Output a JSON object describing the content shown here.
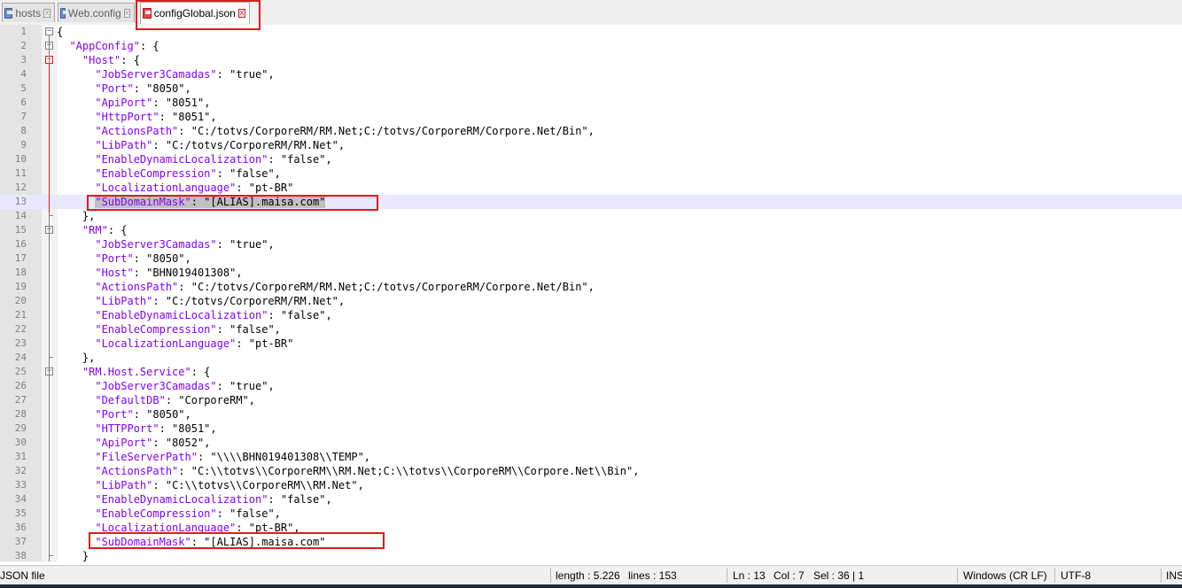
{
  "tabs": [
    {
      "label": "hosts",
      "close": "x",
      "active": false
    },
    {
      "label": "Web.config",
      "close": "x",
      "active": false
    },
    {
      "label": "configGlobal.json",
      "close": "x",
      "active": true
    }
  ],
  "editor": {
    "current_line": 13,
    "lines": [
      {
        "n": "1",
        "text": "{"
      },
      {
        "n": "2",
        "text": "  \"AppConfig\": {"
      },
      {
        "n": "3",
        "text": "    \"Host\": {"
      },
      {
        "n": "4",
        "text": "      \"JobServer3Camadas\": \"true\","
      },
      {
        "n": "5",
        "text": "      \"Port\": \"8050\","
      },
      {
        "n": "6",
        "text": "      \"ApiPort\": \"8051\","
      },
      {
        "n": "7",
        "text": "      \"HttpPort\": \"8051\","
      },
      {
        "n": "8",
        "text": "      \"ActionsPath\": \"C:/totvs/CorporeRM/RM.Net;C:/totvs/CorporeRM/Corpore.Net/Bin\","
      },
      {
        "n": "9",
        "text": "      \"LibPath\": \"C:/totvs/CorporeRM/RM.Net\","
      },
      {
        "n": "10",
        "text": "      \"EnableDynamicLocalization\": \"false\","
      },
      {
        "n": "11",
        "text": "      \"EnableCompression\": \"false\","
      },
      {
        "n": "12",
        "text": "      \"LocalizationLanguage\": \"pt-BR\""
      },
      {
        "n": "13",
        "text": "      \"SubDomainMask\": \"[ALIAS].maisa.com\""
      },
      {
        "n": "14",
        "text": "    },"
      },
      {
        "n": "15",
        "text": "    \"RM\": {"
      },
      {
        "n": "16",
        "text": "      \"JobServer3Camadas\": \"true\","
      },
      {
        "n": "17",
        "text": "      \"Port\": \"8050\","
      },
      {
        "n": "18",
        "text": "      \"Host\": \"BHN019401308\","
      },
      {
        "n": "19",
        "text": "      \"ActionsPath\": \"C:/totvs/CorporeRM/RM.Net;C:/totvs/CorporeRM/Corpore.Net/Bin\","
      },
      {
        "n": "20",
        "text": "      \"LibPath\": \"C:/totvs/CorporeRM/RM.Net\","
      },
      {
        "n": "21",
        "text": "      \"EnableDynamicLocalization\": \"false\","
      },
      {
        "n": "22",
        "text": "      \"EnableCompression\": \"false\","
      },
      {
        "n": "23",
        "text": "      \"LocalizationLanguage\": \"pt-BR\""
      },
      {
        "n": "24",
        "text": "    },"
      },
      {
        "n": "25",
        "text": "    \"RM.Host.Service\": {"
      },
      {
        "n": "26",
        "text": "      \"JobServer3Camadas\": \"true\","
      },
      {
        "n": "27",
        "text": "      \"DefaultDB\": \"CorporeRM\","
      },
      {
        "n": "28",
        "text": "      \"Port\": \"8050\","
      },
      {
        "n": "29",
        "text": "      \"HTTPPort\": \"8051\","
      },
      {
        "n": "30",
        "text": "      \"ApiPort\": \"8052\","
      },
      {
        "n": "31",
        "text": "      \"FileServerPath\": \"\\\\\\\\BHN019401308\\\\TEMP\","
      },
      {
        "n": "32",
        "text": "      \"ActionsPath\": \"C:\\\\totvs\\\\CorporeRM\\\\RM.Net;C:\\\\totvs\\\\CorporeRM\\\\Corpore.Net\\\\Bin\","
      },
      {
        "n": "33",
        "text": "      \"LibPath\": \"C:\\\\totvs\\\\CorporeRM\\\\RM.Net\","
      },
      {
        "n": "34",
        "text": "      \"EnableDynamicLocalization\": \"false\","
      },
      {
        "n": "35",
        "text": "      \"EnableCompression\": \"false\","
      },
      {
        "n": "36",
        "text": "      \"LocalizationLanguage\": \"pt-BR\","
      },
      {
        "n": "37",
        "text": "      \"SubDomainMask\": \"[ALIAS].maisa.com\""
      },
      {
        "n": "38",
        "text": "    }"
      }
    ]
  },
  "status": {
    "file_type": "JSON file",
    "length": "length : 5.226",
    "lines": "lines : 153",
    "ln": "Ln : 13",
    "col": "Col : 7",
    "sel": "Sel : 36 | 1",
    "eol": "Windows (CR LF)",
    "encoding": "UTF-8",
    "mode": "INS"
  },
  "colors": {
    "key": "#8000ff",
    "current_line": "#e8e8ff",
    "highlight_box": "#e01b1b",
    "gutter": "#e4e4e4"
  },
  "icons": {
    "tab_file": "file-icon",
    "tab_close": "close-icon",
    "fold_open": "fold-minus-icon"
  }
}
